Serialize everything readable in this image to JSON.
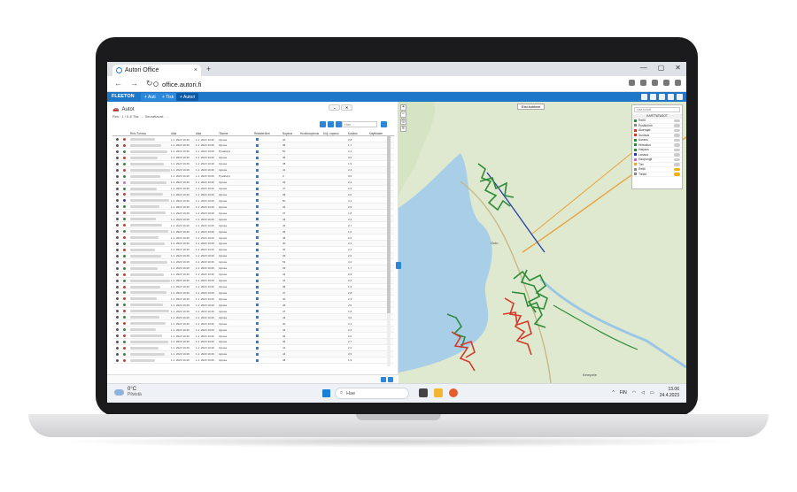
{
  "browser": {
    "tab_title": "Autori Office",
    "tab_close": "×",
    "new_tab": "+",
    "window_controls": [
      "—",
      "▢",
      "✕"
    ],
    "nav": [
      "←",
      "→",
      "↻"
    ],
    "url": "office.autori.fi"
  },
  "app": {
    "logo": "FLEETON",
    "tabs": [
      "+ Auti",
      "+ Tisk",
      "+ Autori"
    ],
    "active_tab": 2
  },
  "list_panel": {
    "title": "Autot",
    "filter_line": "Rek.: 1 / 0-8 Tila: … Seurattavat: …",
    "search_placeholder": "Hae…",
    "columns": [
      "Rek./Tunnus",
      "Aika",
      "Aika",
      "Tilanne",
      "Rekisteröinti",
      "Nopeus",
      "Huoltosopimus",
      "Kulj. nopeus",
      "Kulutus",
      "Käyttöaste"
    ],
    "rows": [
      {
        "c": "#d23a2a",
        "t1": "1.1. 2023 10:26",
        "t2": "1.1. 2023 10:26",
        "s": "Ajossa",
        "v": "40",
        "q": "2,8"
      },
      {
        "c": "#c0392b",
        "t1": "1.1. 2023 10:26",
        "t2": "1.1. 2023 10:26",
        "s": "Ajossa",
        "v": "36",
        "q": "1,7"
      },
      {
        "c": "#2e8b3a",
        "t1": "1.1. 2023 10:26",
        "t2": "1.1. 2023 10:26",
        "s": "Pysähdys",
        "v": "52",
        "q": "2,1"
      },
      {
        "c": "#d23a2a",
        "t1": "1.1. 2023 10:26",
        "t2": "1.1. 2023 10:26",
        "s": "Ajossa",
        "v": "45",
        "q": "3,0"
      },
      {
        "c": "#2e8b3a",
        "t1": "1.1. 2023 10:26",
        "t2": "1.1. 2023 10:26",
        "s": "Ajossa",
        "v": "38",
        "q": "1,9"
      },
      {
        "c": "#d23a2a",
        "t1": "1.1. 2023 10:26",
        "t2": "1.1. 2023 10:26",
        "s": "Ajossa",
        "v": "41",
        "q": "2,4"
      },
      {
        "c": "#2e8b3a",
        "t1": "1.1. 2023 10:26",
        "t2": "1.1. 2023 10:26",
        "s": "Pysähdys",
        "v": "0",
        "q": "0,0"
      },
      {
        "c": "#c070c0",
        "t1": "1.1. 2023 10:26",
        "t2": "1.1. 2023 10:26",
        "s": "Ajossa",
        "v": "33",
        "q": "2,2"
      },
      {
        "c": "#2e8b3a",
        "t1": "1.1. 2023 10:26",
        "t2": "1.1. 2023 10:26",
        "s": "Ajossa",
        "v": "47",
        "q": "2,6"
      },
      {
        "c": "#d23a2a",
        "t1": "1.1. 2023 10:26",
        "t2": "1.1. 2023 10:26",
        "s": "Ajossa",
        "v": "39",
        "q": "2,0"
      },
      {
        "c": "#2a3aa8",
        "t1": "1.1. 2023 10:26",
        "t2": "1.1. 2023 10:26",
        "s": "Ajossa",
        "v": "50",
        "q": "3,1"
      },
      {
        "c": "#2e8b3a",
        "t1": "1.1. 2023 10:26",
        "t2": "1.1. 2023 10:26",
        "s": "Ajossa",
        "v": "44",
        "q": "2,5"
      },
      {
        "c": "#d23a2a",
        "t1": "1.1. 2023 10:26",
        "t2": "1.1. 2023 10:26",
        "s": "Ajossa",
        "v": "37",
        "q": "1,8"
      },
      {
        "c": "#2e8b3a",
        "t1": "1.1. 2023 10:26",
        "t2": "1.1. 2023 10:26",
        "s": "Ajossa",
        "v": "42",
        "q": "2,3"
      },
      {
        "c": "#d23a2a",
        "t1": "1.1. 2023 10:26",
        "t2": "1.1. 2023 10:26",
        "s": "Ajossa",
        "v": "46",
        "q": "2,7"
      },
      {
        "c": "#2e8b3a",
        "t1": "1.1. 2023 10:26",
        "t2": "1.1. 2023 10:26",
        "s": "Ajossa",
        "v": "35",
        "q": "1,6"
      },
      {
        "c": "#d23a2a",
        "t1": "1.1. 2023 10:26",
        "t2": "1.1. 2023 10:26",
        "s": "Ajossa",
        "v": "48",
        "q": "2,9"
      },
      {
        "c": "#2e8b3a",
        "t1": "1.1. 2023 10:26",
        "t2": "1.1. 2023 10:26",
        "s": "Ajossa",
        "v": "40",
        "q": "2,1"
      },
      {
        "c": "#d23a2a",
        "t1": "1.1. 2023 10:26",
        "t2": "1.1. 2023 10:26",
        "s": "Ajossa",
        "v": "43",
        "q": "2,4"
      },
      {
        "c": "#2e8b3a",
        "t1": "1.1. 2023 10:26",
        "t2": "1.1. 2023 10:26",
        "s": "Ajossa",
        "v": "39",
        "q": "2,0"
      },
      {
        "c": "#d23a2a",
        "t1": "1.1. 2023 10:26",
        "t2": "1.1. 2023 10:26",
        "s": "Ajossa",
        "v": "51",
        "q": "3,2"
      },
      {
        "c": "#2e8b3a",
        "t1": "1.1. 2023 10:26",
        "t2": "1.1. 2023 10:26",
        "s": "Ajossa",
        "v": "36",
        "q": "1,7"
      },
      {
        "c": "#d23a2a",
        "t1": "1.1. 2023 10:26",
        "t2": "1.1. 2023 10:26",
        "s": "Ajossa",
        "v": "44",
        "q": "2,5"
      },
      {
        "c": "#2e8b3a",
        "t1": "1.1. 2023 10:26",
        "t2": "1.1. 2023 10:26",
        "s": "Ajossa",
        "v": "41",
        "q": "2,2"
      },
      {
        "c": "#d23a2a",
        "t1": "1.1. 2023 10:26",
        "t2": "1.1. 2023 10:26",
        "s": "Ajossa",
        "v": "38",
        "q": "1,9"
      },
      {
        "c": "#2e8b3a",
        "t1": "1.1. 2023 10:26",
        "t2": "1.1. 2023 10:26",
        "s": "Ajossa",
        "v": "47",
        "q": "2,8"
      },
      {
        "c": "#d23a2a",
        "t1": "1.1. 2023 10:26",
        "t2": "1.1. 2023 10:26",
        "s": "Ajossa",
        "v": "42",
        "q": "2,3"
      },
      {
        "c": "#2e8b3a",
        "t1": "1.1. 2023 10:26",
        "t2": "1.1. 2023 10:26",
        "s": "Ajossa",
        "v": "45",
        "q": "2,6"
      },
      {
        "c": "#d23a2a",
        "t1": "1.1. 2023 10:26",
        "t2": "1.1. 2023 10:26",
        "s": "Ajossa",
        "v": "37",
        "q": "1,8"
      },
      {
        "c": "#2e8b3a",
        "t1": "1.1. 2023 10:26",
        "t2": "1.1. 2023 10:26",
        "s": "Ajossa",
        "v": "49",
        "q": "3,0"
      },
      {
        "c": "#d23a2a",
        "t1": "1.1. 2023 10:26",
        "t2": "1.1. 2023 10:26",
        "s": "Ajossa",
        "v": "40",
        "q": "2,1"
      },
      {
        "c": "#2e8b3a",
        "t1": "1.1. 2023 10:26",
        "t2": "1.1. 2023 10:26",
        "s": "Ajossa",
        "v": "43",
        "q": "2,4"
      },
      {
        "c": "#d23a2a",
        "t1": "1.1. 2023 10:26",
        "t2": "1.1. 2023 10:26",
        "s": "Ajossa",
        "v": "39",
        "q": "2,0"
      },
      {
        "c": "#2e8b3a",
        "t1": "1.1. 2023 10:26",
        "t2": "1.1. 2023 10:26",
        "s": "Ajossa",
        "v": "46",
        "q": "2,7"
      },
      {
        "c": "#d23a2a",
        "t1": "1.1. 2023 10:26",
        "t2": "1.1. 2023 10:26",
        "s": "Ajossa",
        "v": "41",
        "q": "2,2"
      },
      {
        "c": "#2e8b3a",
        "t1": "1.1. 2023 10:26",
        "t2": "1.1. 2023 10:26",
        "s": "Ajossa",
        "v": "44",
        "q": "2,5"
      },
      {
        "c": "#d23a2a",
        "t1": "1.1. 2023 10:26",
        "t2": "1.1. 2023 10:26",
        "s": "Ajossa",
        "v": "38",
        "q": "1,9"
      }
    ]
  },
  "map": {
    "badge": "Etsi kohteet",
    "city": "Oulu",
    "town": "Kempele",
    "layers_search": "Hae kohde",
    "layers_head": "KARTTATASOT",
    "layers": [
      {
        "label": "Reitit",
        "color": "#2e8b3a",
        "on": false
      },
      {
        "label": "Pysäköinti",
        "color": "#888888",
        "on": false
      },
      {
        "label": "Aluerajat",
        "color": "#d23a2a",
        "on": false
      },
      {
        "label": "Suolaus",
        "color": "#d23a2a",
        "on": false
      },
      {
        "label": "Auraus",
        "color": "#2e8b3a",
        "on": false
      },
      {
        "label": "Hiekoitus",
        "color": "#2e8b3a",
        "on": false
      },
      {
        "label": "Harjaus",
        "color": "#2e8b3a",
        "on": false
      },
      {
        "label": "Lanaus",
        "color": "#2a3aa8",
        "on": false
      },
      {
        "label": "Kaupungit",
        "color": "#c070c0",
        "on": false
      },
      {
        "label": "Tiet",
        "color": "#e8a33a",
        "on": false
      },
      {
        "label": "Reitti",
        "color": "#888888",
        "on": true
      },
      {
        "label": "Tiestö",
        "color": "#888888",
        "on": true
      }
    ]
  },
  "taskbar": {
    "temp": "0°C",
    "weather": "Pilvistä",
    "search": "Hae",
    "lang": "FIN",
    "time": "13.06",
    "date": "24.4.2023"
  }
}
